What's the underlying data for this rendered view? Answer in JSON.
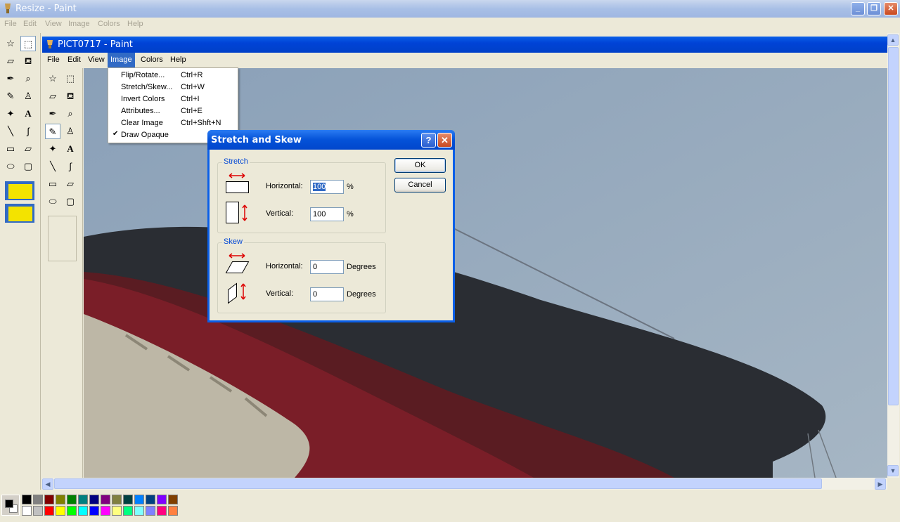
{
  "outer_window": {
    "title": "Resize - Paint",
    "menu": [
      "File",
      "Edit",
      "View",
      "Image",
      "Colors",
      "Help"
    ]
  },
  "inner_window": {
    "title": "PICT0717 - Paint",
    "menu": [
      "File",
      "Edit",
      "View",
      "Image",
      "Colors",
      "Help"
    ],
    "active_menu": "Image"
  },
  "image_menu": {
    "items": [
      {
        "label": "Flip/Rotate...",
        "shortcut": "Ctrl+R"
      },
      {
        "label": "Stretch/Skew...",
        "shortcut": "Ctrl+W"
      },
      {
        "label": "Invert Colors",
        "shortcut": "Ctrl+I"
      },
      {
        "label": "Attributes...",
        "shortcut": "Ctrl+E"
      },
      {
        "label": "Clear Image",
        "shortcut": "Ctrl+Shft+N"
      },
      {
        "label": "Draw Opaque",
        "shortcut": "",
        "checked": true
      }
    ]
  },
  "dialog": {
    "title": "Stretch and Skew",
    "help_symbol": "?",
    "close_symbol": "✕",
    "stretch": {
      "group_label": "Stretch",
      "horizontal_label": "Horizontal:",
      "horizontal_value": "100",
      "horizontal_unit": "%",
      "vertical_label": "Vertical:",
      "vertical_value": "100",
      "vertical_unit": "%"
    },
    "skew": {
      "group_label": "Skew",
      "horizontal_label": "Horizontal:",
      "horizontal_value": "0",
      "horizontal_unit": "Degrees",
      "vertical_label": "Vertical:",
      "vertical_value": "0",
      "vertical_unit": "Degrees"
    },
    "ok_label": "OK",
    "cancel_label": "Cancel"
  },
  "palette": {
    "foreground": "#000000",
    "background": "#ffffff",
    "row1": [
      "#000000",
      "#808080",
      "#800000",
      "#808000",
      "#008000",
      "#008080",
      "#000080",
      "#800080",
      "#808040",
      "#004040",
      "#0080ff",
      "#004080",
      "#8000ff",
      "#804000"
    ],
    "row2": [
      "#ffffff",
      "#c0c0c0",
      "#ff0000",
      "#ffff00",
      "#00ff00",
      "#00ffff",
      "#0000ff",
      "#ff00ff",
      "#ffff80",
      "#00ff80",
      "#80ffff",
      "#8080ff",
      "#ff0080",
      "#ff8040"
    ]
  },
  "colors": {
    "titlebar_active": "#0043d6",
    "titlebar_inactive": "#a8bfe6",
    "menu_highlight": "#316ac5",
    "group_label": "#0046d5"
  }
}
